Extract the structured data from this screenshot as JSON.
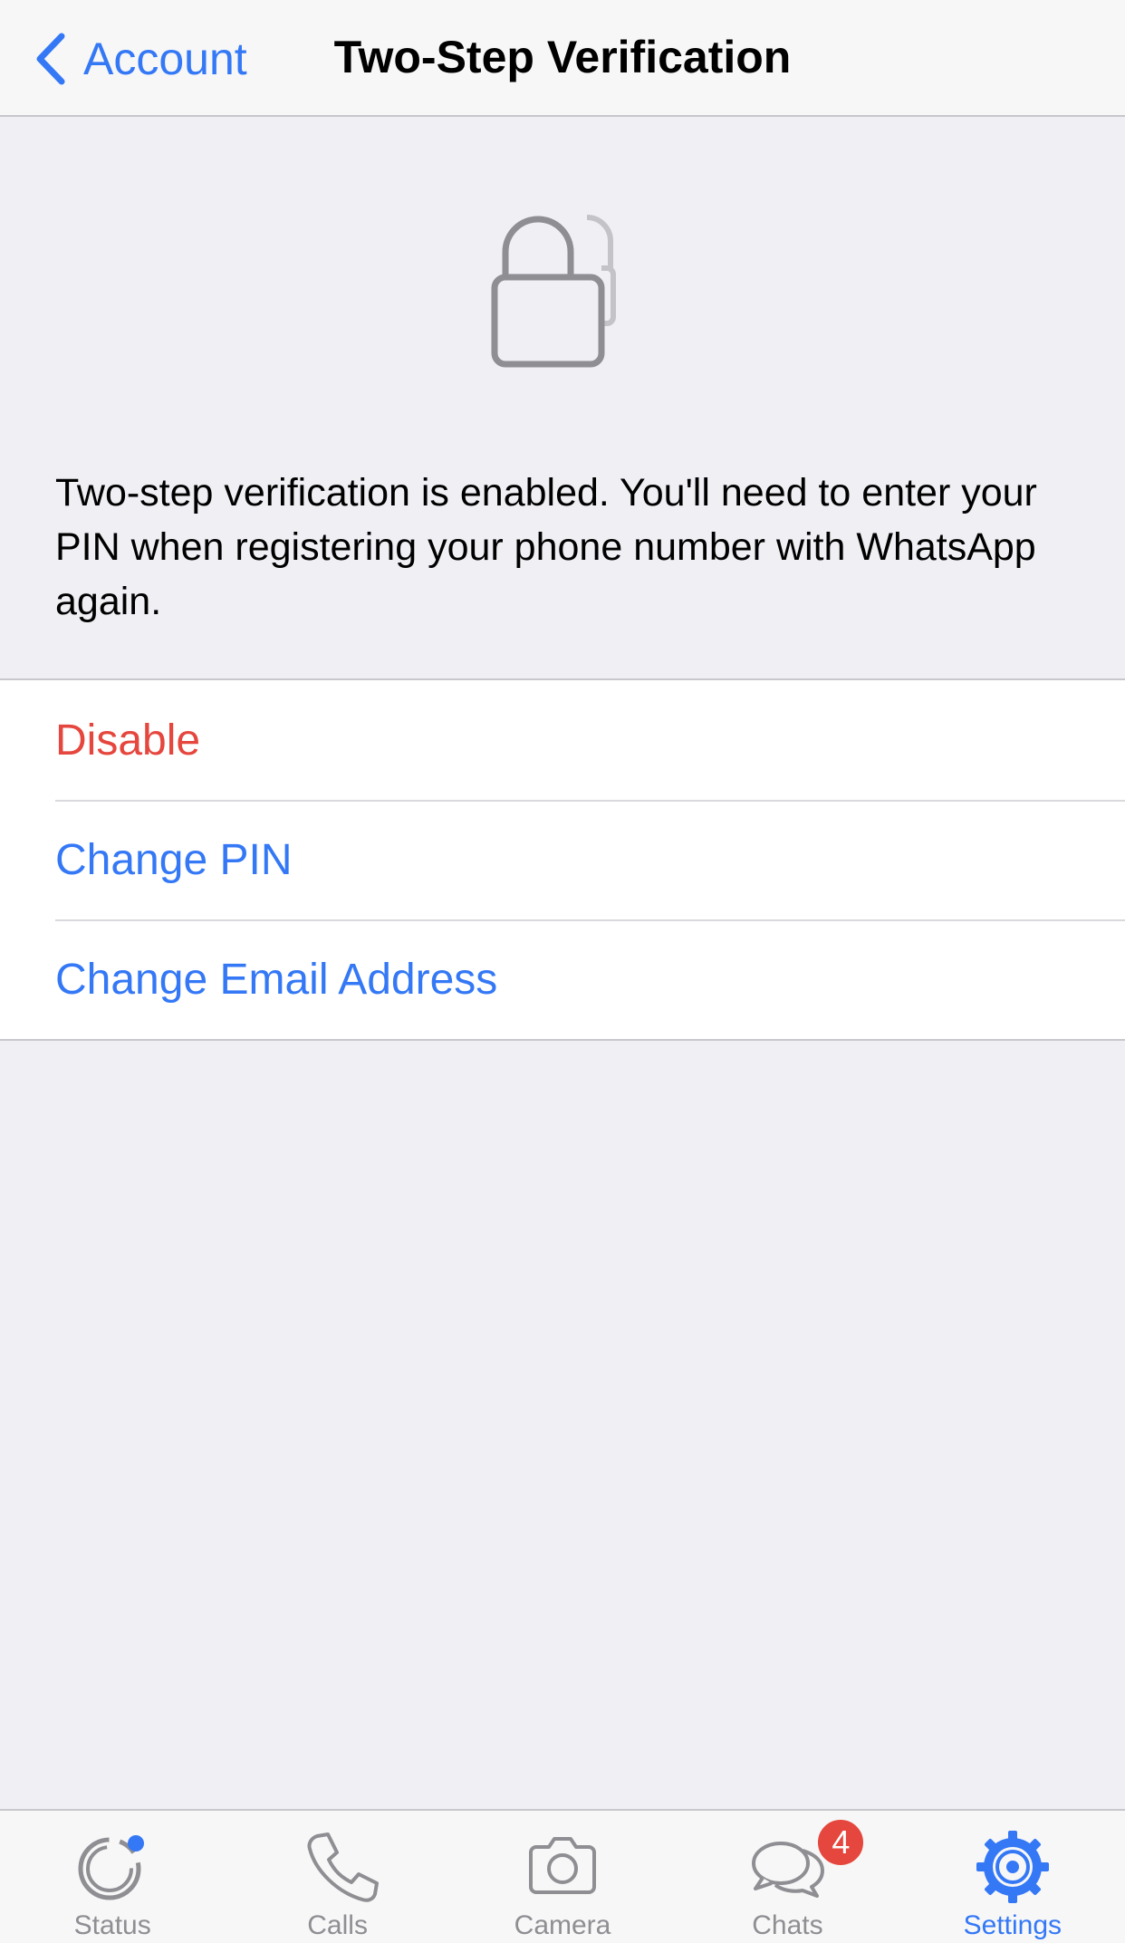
{
  "nav": {
    "back_label": "Account",
    "title": "Two-Step Verification"
  },
  "description": "Two-step verification is enabled. You'll need to enter your PIN when registering your phone number with WhatsApp again.",
  "actions": [
    {
      "label": "Disable",
      "color": "#e5463d"
    },
    {
      "label": "Change PIN",
      "color": "#3478f6"
    },
    {
      "label": "Change Email Address",
      "color": "#3478f6"
    }
  ],
  "tabbar": {
    "tabs": [
      {
        "label": "Status",
        "icon": "status-icon"
      },
      {
        "label": "Calls",
        "icon": "phone-icon"
      },
      {
        "label": "Camera",
        "icon": "camera-icon"
      },
      {
        "label": "Chats",
        "icon": "chat-bubbles-icon",
        "badge": "4"
      },
      {
        "label": "Settings",
        "icon": "gear-icon",
        "active": true
      }
    ]
  },
  "colors": {
    "accent": "#3478f6",
    "destructive": "#e5463d",
    "background": "#efeff4"
  }
}
